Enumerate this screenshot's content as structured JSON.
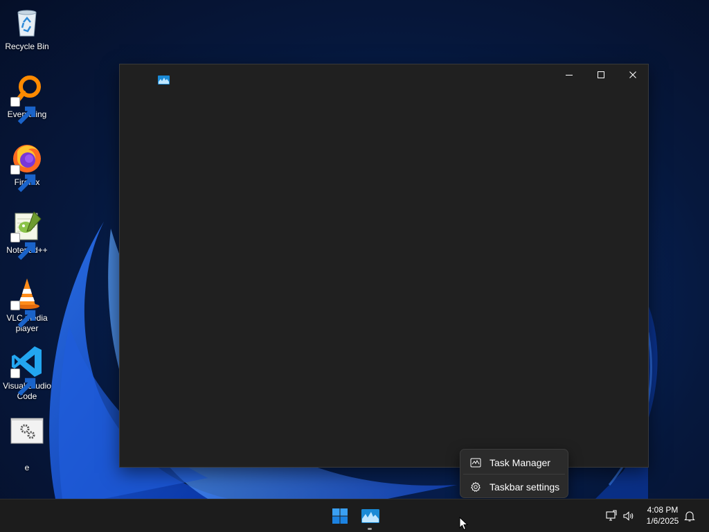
{
  "desktop": {
    "icons": [
      {
        "label": "Recycle Bin",
        "icon": "recycle-bin-icon",
        "shortcut": false
      },
      {
        "label": "Everything",
        "icon": "everything-search-icon",
        "shortcut": true
      },
      {
        "label": "Firefox",
        "icon": "firefox-icon",
        "shortcut": true
      },
      {
        "label": "Notepad++",
        "icon": "notepad-plus-plus-icon",
        "shortcut": true
      },
      {
        "label": "VLC media player",
        "icon": "vlc-cone-icon",
        "shortcut": true
      },
      {
        "label": "Visual Studio Code",
        "icon": "vscode-icon",
        "shortcut": true
      },
      {
        "label": "e",
        "icon": "settings-gears-icon",
        "shortcut": false
      }
    ]
  },
  "window": {
    "title": "",
    "app_icon": "task-manager-icon",
    "controls": [
      "minimize-icon",
      "maximize-icon",
      "close-icon"
    ],
    "background_color": "#202020"
  },
  "context_menu": {
    "items": [
      {
        "label": "Task Manager",
        "icon": "task-manager-icon"
      },
      {
        "label": "Taskbar settings",
        "icon": "gear-icon"
      }
    ]
  },
  "taskbar": {
    "start_icon": "windows-start-icon",
    "pinned": [
      {
        "name": "Task Manager",
        "icon": "task-manager-icon",
        "active": true
      }
    ],
    "tray_icons": [
      "network-icon",
      "volume-icon"
    ],
    "clock": {
      "time": "4:08 PM",
      "date": "1/6/2025"
    },
    "notification_icon": "bell-icon"
  },
  "colors": {
    "accent": "#0078d4",
    "taskbar": "#1c1c1c",
    "menu": "#2b2b2b",
    "wallpaper_dark": "#061634"
  }
}
